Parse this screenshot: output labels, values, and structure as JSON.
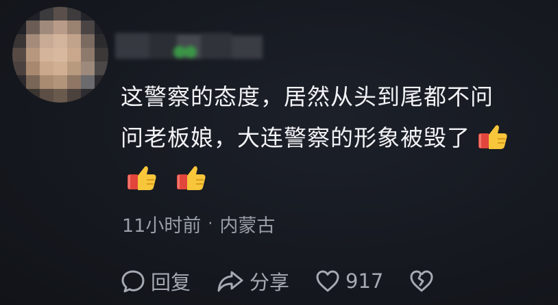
{
  "comment": {
    "line1": "这警察的态度，居然从头到尾都不问",
    "line2": "问老板娘，大连警察的形象被毁了"
  },
  "emojis": [
    "thumbs-up-icon",
    "thumbs-up-icon",
    "thumbs-up-icon"
  ],
  "meta": {
    "time": "11小时前",
    "separator": "·",
    "location": "内蒙古"
  },
  "actions": {
    "reply_label": "回复",
    "share_label": "分享",
    "like_count": "917"
  },
  "icons": {
    "reply": "comment-bubble-icon",
    "share": "share-arrow-icon",
    "like": "heart-icon",
    "dislike": "broken-heart-icon"
  },
  "colors": {
    "background": "#15181f",
    "text": "#f2f3f6",
    "muted": "#9a9ea8"
  }
}
